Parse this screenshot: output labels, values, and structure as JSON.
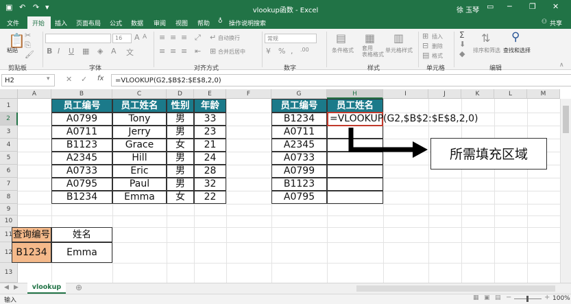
{
  "window": {
    "title": "vlookup函数 - Excel",
    "user": "徐 玉琴",
    "share": "共享",
    "minimize": "─",
    "restore": "❐",
    "close": "✕"
  },
  "tabs": [
    "文件",
    "开始",
    "插入",
    "页面布局",
    "公式",
    "数据",
    "审阅",
    "视图",
    "帮助"
  ],
  "tell_me": "操作说明搜索",
  "ribbon": {
    "paste": "粘贴",
    "clipboard": "剪贴板",
    "font_group": "字体",
    "font_size": "16",
    "align_group": "对齐方式",
    "wrap": "自动换行",
    "merge": "合并后居中",
    "number_group": "数字",
    "number_format": "常规",
    "cond_format": "条件格式",
    "table_format": "套用\n表格格式",
    "cell_style": "单元格样式",
    "styles_group": "样式",
    "insert": "插入",
    "delete": "删除",
    "format": "格式",
    "cells_group": "单元格",
    "sort_filter": "排序和筛选",
    "find_select": "查找和选择",
    "edit_group": "编辑",
    "font_bold": "B",
    "font_italic": "I",
    "font_underline": "U",
    "sigma": "Σ"
  },
  "formula_bar": {
    "name_box": "H2",
    "fx": "fx",
    "formula": "=VLOOKUP(G2,$B$2:$E$8,2,0)"
  },
  "columns": [
    "A",
    "B",
    "C",
    "D",
    "E",
    "F",
    "G",
    "H",
    "I",
    "J",
    "K",
    "L",
    "M"
  ],
  "rows": [
    "1",
    "2",
    "3",
    "4",
    "5",
    "6",
    "7",
    "8",
    "9",
    "10",
    "11",
    "12",
    "13"
  ],
  "employee_table": {
    "headers": [
      "员工编号",
      "员工姓名",
      "性别",
      "年龄"
    ],
    "rows": [
      [
        "A0799",
        "Tony",
        "男",
        "33"
      ],
      [
        "A0711",
        "Jerry",
        "男",
        "23"
      ],
      [
        "B1123",
        "Grace",
        "女",
        "21"
      ],
      [
        "A2345",
        "Hill",
        "男",
        "24"
      ],
      [
        "A0733",
        "Eric",
        "男",
        "28"
      ],
      [
        "A0795",
        "Paul",
        "男",
        "32"
      ],
      [
        "B1234",
        "Emma",
        "女",
        "22"
      ]
    ]
  },
  "lookup_table": {
    "headers": [
      "员工编号",
      "员工姓名"
    ],
    "ids": [
      "B1234",
      "A0711",
      "A2345",
      "A0733",
      "A0799",
      "B1123",
      "A0795"
    ],
    "editing_cell": "=VLOOKUP",
    "editing_rest": "(G2,$B$2:$E$8,2,0)"
  },
  "query": {
    "label": "查询编号",
    "name_label": "姓名",
    "id": "B1234",
    "name": "Emma"
  },
  "annotation": "所需填充区域",
  "sheet_tab": "vlookup",
  "add_sheet": "⊕",
  "status": {
    "mode": "输入",
    "zoom": "100%"
  },
  "colors": {
    "excel_green": "#217346",
    "header_teal": "#1b7a8a",
    "query_orange": "#f4b98a",
    "edit_border": "#c0392b"
  }
}
